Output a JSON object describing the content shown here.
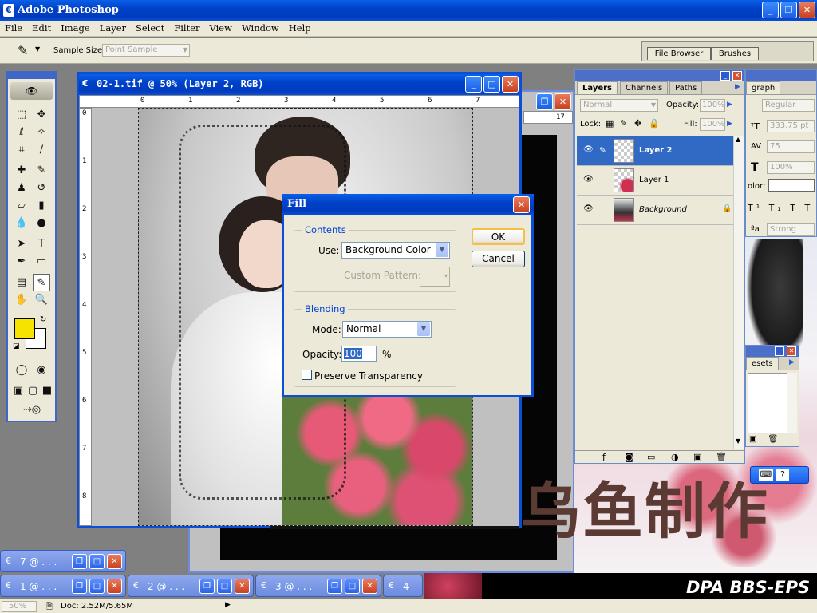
{
  "app": {
    "title": "Adobe Photoshop"
  },
  "menu": [
    "File",
    "Edit",
    "Image",
    "Layer",
    "Select",
    "Filter",
    "View",
    "Window",
    "Help"
  ],
  "options_bar": {
    "sample_size_label": "Sample Size:",
    "sample_size_value": "Point Sample"
  },
  "palette_well": {
    "tabs": [
      "File Browser",
      "Brushes"
    ]
  },
  "document": {
    "title": "02-1.tif @ 50% (Layer 2, RGB)",
    "ruler_top": [
      "0",
      "1",
      "2",
      "3",
      "4",
      "5",
      "6",
      "7"
    ],
    "ruler_left": [
      "0",
      "1",
      "2",
      "3",
      "4",
      "5",
      "6",
      "7",
      "8"
    ]
  },
  "back_document": {
    "ruler_mark": "17",
    "watermark_chars": "乌鱼制作",
    "footer_text": "DPA BBS-EPS"
  },
  "fill_dialog": {
    "title": "Fill",
    "contents_legend": "Contents",
    "use_label": "Use:",
    "use_value": "Background Color",
    "custom_pattern_label": "Custom Pattern:",
    "blending_legend": "Blending",
    "mode_label": "Mode:",
    "mode_value": "Normal",
    "opacity_label": "Opacity:",
    "opacity_value": "100",
    "opacity_unit": "%",
    "preserve_label": "Preserve Transparency",
    "ok_label": "OK",
    "cancel_label": "Cancel"
  },
  "layers_panel": {
    "tabs": [
      "Layers",
      "Channels",
      "Paths"
    ],
    "blend_mode": "Normal",
    "opacity_label": "Opacity:",
    "opacity_value": "100%",
    "lock_label": "Lock:",
    "fill_label": "Fill:",
    "fill_value": "100%",
    "layers": [
      {
        "name": "Layer 2",
        "selected": true
      },
      {
        "name": "Layer 1",
        "selected": false
      },
      {
        "name": "Background",
        "selected": false
      }
    ]
  },
  "character_panel": {
    "tab": "graph",
    "font_style": "Regular",
    "size_value": "333.75 pt",
    "tracking_value": "75",
    "scale_value": "100%",
    "color_label": "olor:",
    "aa_value": "Strong"
  },
  "presets_panel": {
    "tab": "esets"
  },
  "taskbar": [
    {
      "label": "7 @ . . ."
    },
    {
      "label": "1 @ . . ."
    },
    {
      "label": "2 @ . . ."
    },
    {
      "label": "3 @ . . ."
    },
    {
      "label": "4"
    }
  ],
  "status_bar": {
    "zoom": "50%",
    "doc_info": "Doc: 2.52M/5.65M"
  },
  "colors": {
    "foreground": "#f7e300",
    "background": "#ffffff",
    "accent": "#0a5fe8"
  }
}
